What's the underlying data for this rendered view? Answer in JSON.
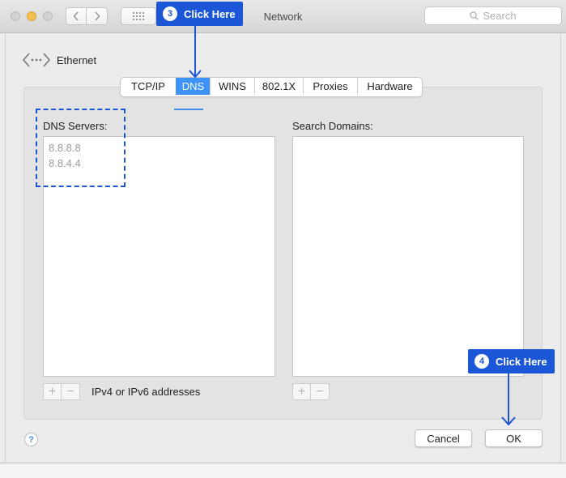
{
  "window": {
    "title": "Network",
    "search_placeholder": "Search"
  },
  "interface": {
    "icon": "ethernet-icon",
    "name": "Ethernet"
  },
  "tabs": [
    {
      "label": "TCP/IP",
      "active": false
    },
    {
      "label": "DNS",
      "active": true
    },
    {
      "label": "WINS",
      "active": false
    },
    {
      "label": "802.1X",
      "active": false
    },
    {
      "label": "Proxies",
      "active": false
    },
    {
      "label": "Hardware",
      "active": false
    }
  ],
  "dns": {
    "label": "DNS Servers:",
    "entries": [
      "8.8.8.8",
      "8.8.4.4"
    ],
    "hint": "IPv4 or IPv6 addresses",
    "add_label": "+",
    "remove_label": "−"
  },
  "search_domains": {
    "label": "Search Domains:",
    "entries": [],
    "add_label": "+",
    "remove_label": "−"
  },
  "buttons": {
    "help": "?",
    "cancel": "Cancel",
    "ok": "OK"
  },
  "annotations": {
    "step3": {
      "number": "3",
      "text": "Click Here"
    },
    "step4": {
      "number": "4",
      "text": "Click Here"
    }
  },
  "colors": {
    "accent_tab": "#3d93f7",
    "annotation_blue": "#1a56d6",
    "traffic_minimize": "#f5bf4f"
  }
}
